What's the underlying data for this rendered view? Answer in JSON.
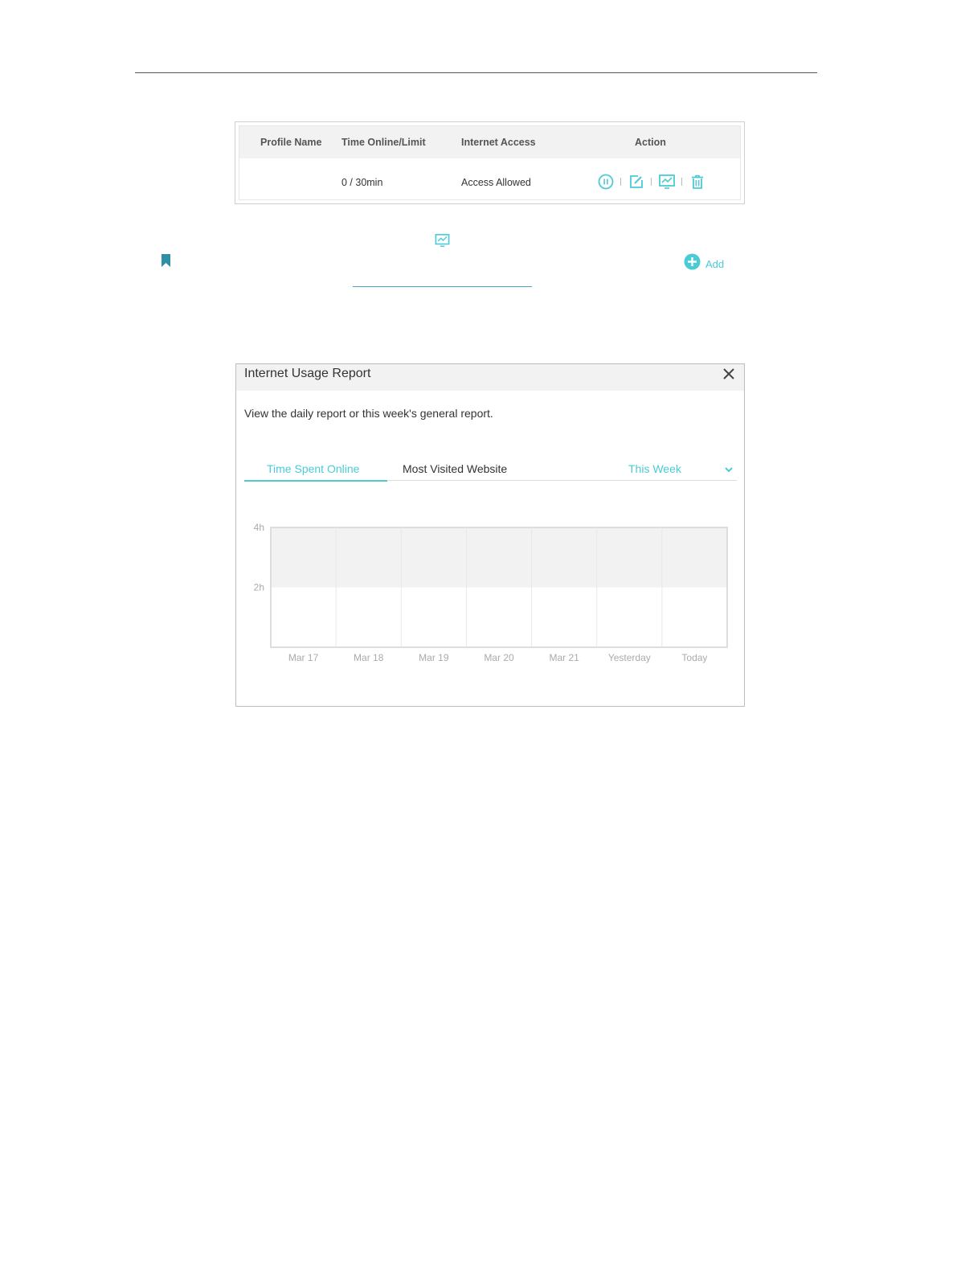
{
  "profiles_table": {
    "headers": [
      "Profile Name",
      "Time Online/Limit",
      "Internet Access",
      "Action"
    ],
    "row": {
      "profile_name": "",
      "time_online_limit": "0 / 30min",
      "internet_access": "Access Allowed"
    },
    "action_icons": [
      "pause-icon",
      "edit-icon",
      "report-icon",
      "delete-icon"
    ]
  },
  "add_button": {
    "label": "Add",
    "icon": "plus-circle-icon"
  },
  "report_dialog": {
    "title": "Internet Usage Report",
    "description": "View the daily report or this week's general report.",
    "tabs": [
      "Time Spent Online",
      "Most Visited Website"
    ],
    "active_tab": "Time Spent Online",
    "period_select": "This Week"
  },
  "colors": {
    "accent": "#4acbd6",
    "bookmark": "#2f8fa6"
  },
  "chart_data": {
    "type": "bar",
    "categories": [
      "Mar 17",
      "Mar 18",
      "Mar 19",
      "Mar 20",
      "Mar 21",
      "Yesterday",
      "Today"
    ],
    "values": [
      0,
      0,
      0,
      0,
      0,
      0,
      0
    ],
    "title": "",
    "xlabel": "",
    "ylabel": "",
    "yticks": [
      "4h",
      "2h"
    ],
    "ylim": [
      0,
      4
    ],
    "grid": true,
    "limit_band": [
      2,
      4
    ]
  }
}
